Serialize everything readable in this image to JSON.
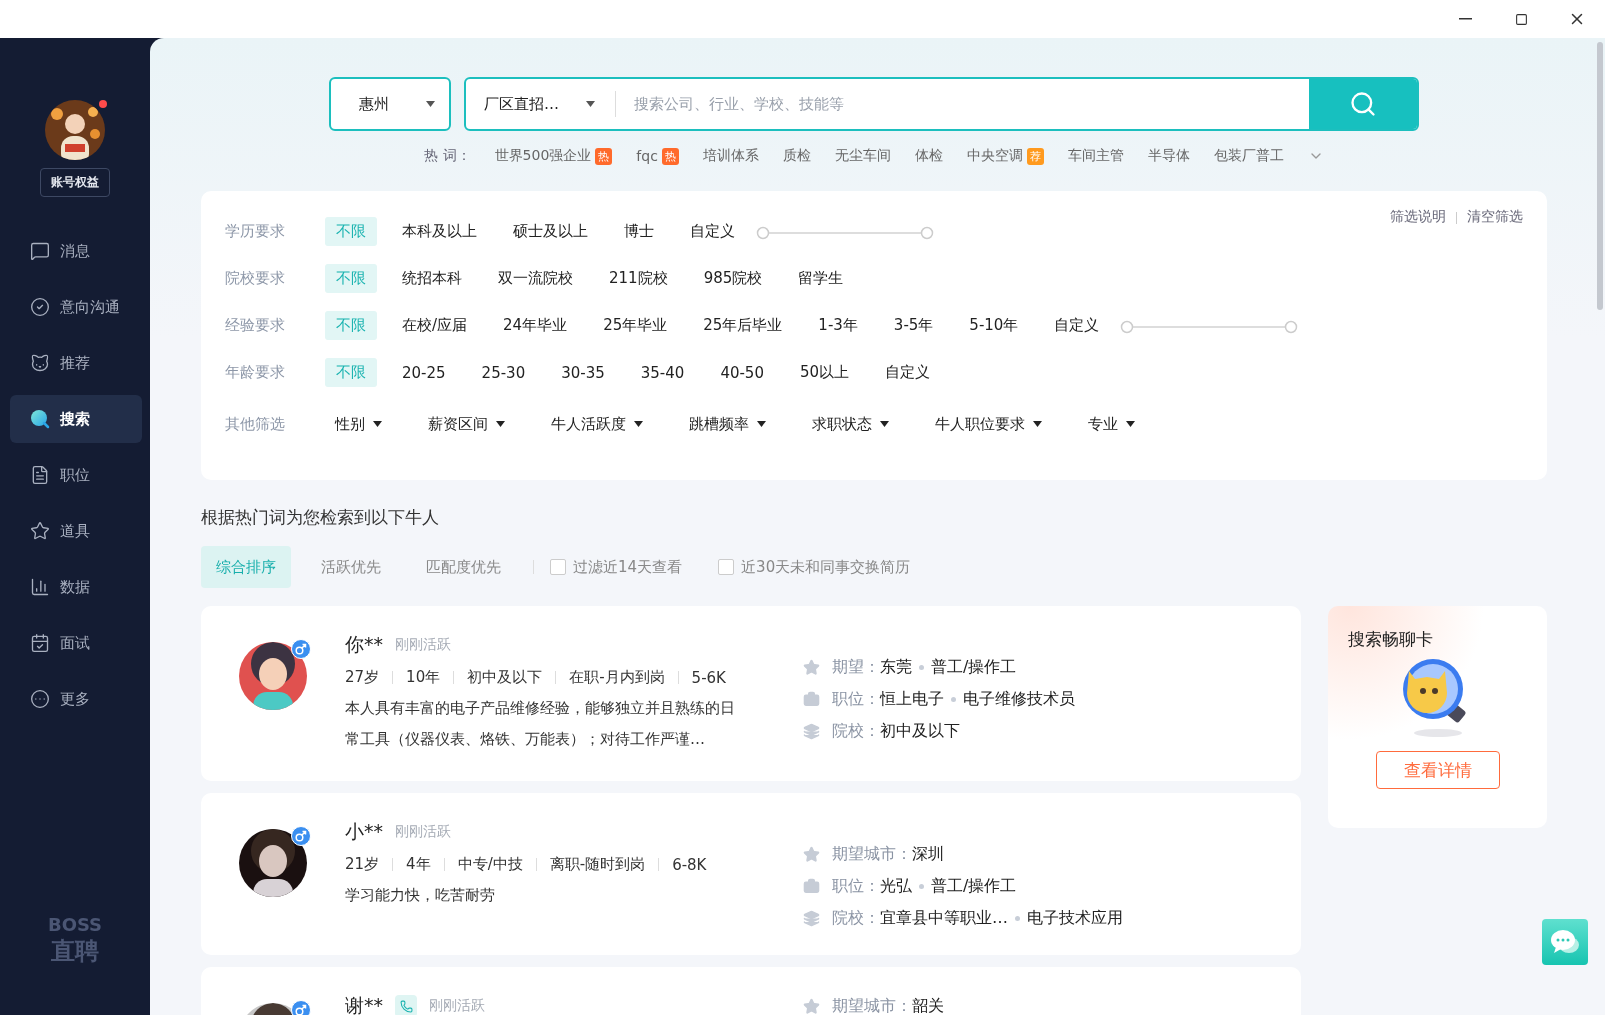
{
  "sidebar": {
    "avatar_notification": true,
    "account_button": "账号权益",
    "items": [
      {
        "label": "消息",
        "selected": false
      },
      {
        "label": "意向沟通",
        "selected": false
      },
      {
        "label": "推荐",
        "selected": false
      },
      {
        "label": "搜索",
        "selected": true
      },
      {
        "label": "职位",
        "selected": false
      },
      {
        "label": "道具",
        "selected": false
      },
      {
        "label": "数据",
        "selected": false
      },
      {
        "label": "面试",
        "selected": false
      },
      {
        "label": "更多",
        "selected": false
      }
    ],
    "logo": {
      "line_1": "BOSS",
      "line_2": "直聘"
    }
  },
  "search": {
    "city": "惠州",
    "category": "厂区直招…",
    "placeholder": "搜索公司、行业、学校、技能等",
    "hot_words": {
      "label": "热 词：",
      "items": [
        {
          "label": "世界500强企业",
          "tag": {
            "text": "热",
            "color": "#ff6a2b"
          }
        },
        {
          "label": "fqc",
          "tag": {
            "text": "热",
            "color": "#ff6a2b"
          }
        },
        {
          "label": "培训体系"
        },
        {
          "label": "质检"
        },
        {
          "label": "无尘车间"
        },
        {
          "label": "体检"
        },
        {
          "label": "中央空调",
          "tag": {
            "text": "荐",
            "color": "#ff9a1e"
          }
        },
        {
          "label": "车间主管"
        },
        {
          "label": "半导体"
        },
        {
          "label": "包装厂普工"
        }
      ]
    }
  },
  "filters": {
    "links": [
      "筛选说明",
      "清空筛选"
    ],
    "rows": [
      {
        "label": "学历要求",
        "range": true,
        "options": [
          {
            "label": "不限",
            "selected": true
          },
          {
            "label": "本科及以上",
            "selected": false
          },
          {
            "label": "硕士及以上",
            "selected": false
          },
          {
            "label": "博士",
            "selected": false
          },
          {
            "label": "自定义",
            "selected": false
          }
        ]
      },
      {
        "label": "院校要求",
        "options": [
          {
            "label": "不限",
            "selected": true
          },
          {
            "label": "统招本科",
            "selected": false
          },
          {
            "label": "双一流院校",
            "selected": false
          },
          {
            "label": "211院校",
            "selected": false
          },
          {
            "label": "985院校",
            "selected": false
          },
          {
            "label": "留学生",
            "selected": false
          }
        ]
      },
      {
        "label": "经验要求",
        "range": true,
        "options": [
          {
            "label": "不限",
            "selected": true
          },
          {
            "label": "在校/应届",
            "selected": false
          },
          {
            "label": "24年毕业",
            "selected": false
          },
          {
            "label": "25年毕业",
            "selected": false
          },
          {
            "label": "25年后毕业",
            "selected": false
          },
          {
            "label": "1-3年",
            "selected": false
          },
          {
            "label": "3-5年",
            "selected": false
          },
          {
            "label": "5-10年",
            "selected": false
          },
          {
            "label": "自定义",
            "selected": false
          }
        ]
      },
      {
        "label": "年龄要求",
        "options": [
          {
            "label": "不限",
            "selected": true
          },
          {
            "label": "20-25",
            "selected": false
          },
          {
            "label": "25-30",
            "selected": false
          },
          {
            "label": "30-35",
            "selected": false
          },
          {
            "label": "35-40",
            "selected": false
          },
          {
            "label": "40-50",
            "selected": false
          },
          {
            "label": "50以上",
            "selected": false
          },
          {
            "label": "自定义",
            "selected": false
          }
        ]
      }
    ],
    "other": {
      "label": "其他筛选",
      "dropdowns": [
        "性别",
        "薪资区间",
        "牛人活跃度",
        "跳槽频率",
        "求职状态",
        "牛人职位要求",
        "专业"
      ]
    }
  },
  "results": {
    "title": "根据热门词为您检索到以下牛人",
    "sort_tabs": [
      {
        "label": "综合排序",
        "selected": true
      },
      {
        "label": "活跃优先",
        "selected": false
      },
      {
        "label": "匹配度优先",
        "selected": false
      }
    ],
    "checkboxes": [
      {
        "label": "过滤近14天查看",
        "checked": false
      },
      {
        "label": "近30天未和同事交换简历",
        "checked": false
      }
    ]
  },
  "candidates": [
    {
      "name": "你**",
      "phone_badge": false,
      "status": "刚刚活跃",
      "facts": [
        "27岁",
        "10年",
        "初中及以下",
        "在职-月内到岗",
        "5-6K"
      ],
      "summary": "本人具有丰富的电子产品维修经验，能够独立并且熟练的日常工具（仪器仪表、烙铁、万能表）；对待工作严谨…",
      "details": [
        {
          "label": "期望：",
          "values": [
            "东莞",
            "普工/操作工"
          ]
        },
        {
          "label": "职位：",
          "values": [
            "恒上电子",
            "电子维修技术员"
          ]
        },
        {
          "label": "院校：",
          "values": [
            "初中及以下"
          ]
        }
      ]
    },
    {
      "name": "小**",
      "phone_badge": false,
      "status": "刚刚活跃",
      "facts": [
        "21岁",
        "4年",
        "中专/中技",
        "离职-随时到岗",
        "6-8K"
      ],
      "summary": "学习能力快，吃苦耐劳",
      "details": [
        {
          "label": "期望城市：",
          "values": [
            "深圳"
          ]
        },
        {
          "label": "职位：",
          "values": [
            "光弘",
            "普工/操作工"
          ]
        },
        {
          "label": "院校：",
          "values": [
            "宜章县中等职业…",
            "电子技术应用"
          ]
        }
      ]
    },
    {
      "name": "谢**",
      "phone_badge": true,
      "status": "刚刚活跃",
      "details": [
        {
          "label": "期望城市：",
          "values": [
            "韶关"
          ]
        }
      ]
    }
  ],
  "promo": {
    "title": "搜索畅聊卡",
    "button": "查看详情"
  }
}
